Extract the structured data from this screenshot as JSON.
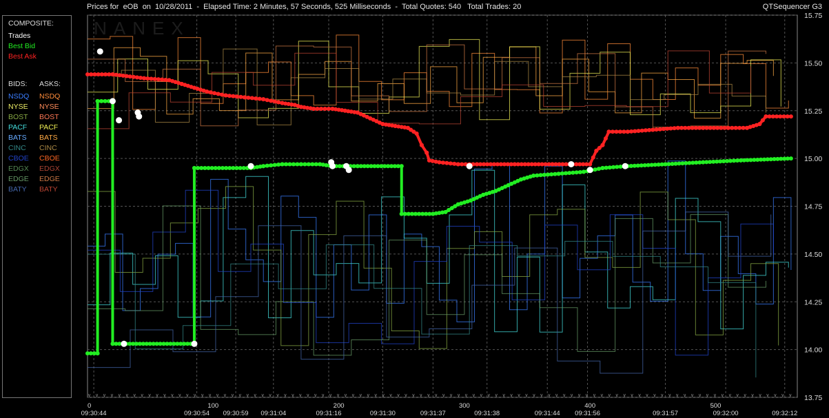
{
  "header": {
    "title": "Prices for  eOB  on  10/28/2011  -  Elapsed Time: 2 Minutes, 57 Seconds, 525 Milliseconds  -  Total Quotes: 540   Total Trades: 20",
    "app_name": "QTSequencer G3",
    "watermark": "NANEX"
  },
  "legend": {
    "composite_label": "COMPOSITE:",
    "composite": [
      {
        "label": "Trades",
        "color": "#ffffff"
      },
      {
        "label": "Best Bid",
        "color": "#22ee22"
      },
      {
        "label": "Best Ask",
        "color": "#ff2222"
      }
    ],
    "bids_label": "BIDS:",
    "asks_label": "ASKS:",
    "exchanges": [
      {
        "bid": "NSDQ",
        "ask": "NSDQ",
        "bid_color": "#3a7dff",
        "ask_color": "#ff8c3a"
      },
      {
        "bid": "NYSE",
        "ask": "NYSE",
        "bid_color": "#eeee66",
        "ask_color": "#ff8c5a"
      },
      {
        "bid": "BOST",
        "ask": "BOST",
        "bid_color": "#88aa44",
        "ask_color": "#ff7755"
      },
      {
        "bid": "PACF",
        "ask": "PACF",
        "bid_color": "#44dddd",
        "ask_color": "#eeee55"
      },
      {
        "bid": "BATS",
        "ask": "BATS",
        "bid_color": "#66aaff",
        "ask_color": "#ffaa44"
      },
      {
        "bid": "CINC",
        "ask": "CINC",
        "bid_color": "#338888",
        "ask_color": "#aa8844"
      },
      {
        "bid": "CBOE",
        "ask": "CBOE",
        "bid_color": "#2244cc",
        "ask_color": "#ff6622"
      },
      {
        "bid": "EDGX",
        "ask": "EDGX",
        "bid_color": "#558855",
        "ask_color": "#aa4433"
      },
      {
        "bid": "EDGE",
        "ask": "EDGE",
        "bid_color": "#669966",
        "ask_color": "#cc7744"
      },
      {
        "bid": "BATY",
        "ask": "BATY",
        "bid_color": "#4466aa",
        "ask_color": "#bb4433"
      }
    ]
  },
  "chart_data": {
    "type": "line",
    "title": "Prices for eOB on 10/28/2011",
    "ylim": [
      13.75,
      15.75
    ],
    "y_ticks": [
      "15.75",
      "15.50",
      "15.25",
      "15.00",
      "14.75",
      "14.50",
      "14.25",
      "14.00",
      "13.75"
    ],
    "x_ticks": [
      {
        "seq": 0,
        "label": "0"
      },
      {
        "seq": 100,
        "label": "100"
      },
      {
        "seq": 200,
        "label": "200"
      },
      {
        "seq": 300,
        "label": "300"
      },
      {
        "seq": 400,
        "label": "400"
      },
      {
        "seq": 500,
        "label": "500"
      }
    ],
    "x_range": [
      0,
      565
    ],
    "time_labels": [
      {
        "seq": 5,
        "label": "09:30:44"
      },
      {
        "seq": 87,
        "label": "09:30:54"
      },
      {
        "seq": 118,
        "label": "09:30:59"
      },
      {
        "seq": 148,
        "label": "09:31:04"
      },
      {
        "seq": 192,
        "label": "09:31:16"
      },
      {
        "seq": 235,
        "label": "09:31:30"
      },
      {
        "seq": 275,
        "label": "09:31:37"
      },
      {
        "seq": 318,
        "label": "09:31:38"
      },
      {
        "seq": 366,
        "label": "09:31:44"
      },
      {
        "seq": 398,
        "label": "09:31:56"
      },
      {
        "seq": 460,
        "label": "09:31:57"
      },
      {
        "seq": 508,
        "label": "09:32:00"
      },
      {
        "seq": 555,
        "label": "09:32:12"
      }
    ],
    "series": [
      {
        "name": "Best Ask",
        "color": "#ff2222",
        "points": [
          [
            0,
            15.44
          ],
          [
            20,
            15.44
          ],
          [
            45,
            15.42
          ],
          [
            65,
            15.41
          ],
          [
            75,
            15.39
          ],
          [
            85,
            15.37
          ],
          [
            95,
            15.35
          ],
          [
            110,
            15.33
          ],
          [
            125,
            15.32
          ],
          [
            140,
            15.31
          ],
          [
            155,
            15.29
          ],
          [
            165,
            15.28
          ],
          [
            170,
            15.27
          ],
          [
            180,
            15.26
          ],
          [
            195,
            15.26
          ],
          [
            205,
            15.25
          ],
          [
            215,
            15.24
          ],
          [
            225,
            15.21
          ],
          [
            235,
            15.18
          ],
          [
            245,
            15.17
          ],
          [
            255,
            15.16
          ],
          [
            262,
            15.13
          ],
          [
            266,
            15.07
          ],
          [
            270,
            15.03
          ],
          [
            272,
            14.99
          ],
          [
            280,
            14.98
          ],
          [
            295,
            14.97
          ],
          [
            310,
            14.97
          ],
          [
            340,
            14.97
          ],
          [
            370,
            14.97
          ],
          [
            400,
            14.97
          ],
          [
            405,
            15.04
          ],
          [
            410,
            15.07
          ],
          [
            415,
            15.14
          ],
          [
            430,
            15.14
          ],
          [
            450,
            15.15
          ],
          [
            470,
            15.16
          ],
          [
            490,
            15.16
          ],
          [
            510,
            15.16
          ],
          [
            525,
            15.16
          ],
          [
            535,
            15.18
          ],
          [
            540,
            15.22
          ],
          [
            560,
            15.22
          ]
        ]
      },
      {
        "name": "Best Bid",
        "color": "#22ee22",
        "points": [
          [
            0,
            13.98
          ],
          [
            8,
            13.98
          ],
          [
            8,
            15.3
          ],
          [
            20,
            15.3
          ],
          [
            20,
            14.03
          ],
          [
            85,
            14.03
          ],
          [
            85,
            14.95
          ],
          [
            130,
            14.95
          ],
          [
            140,
            14.96
          ],
          [
            155,
            14.97
          ],
          [
            170,
            14.97
          ],
          [
            185,
            14.97
          ],
          [
            195,
            14.96
          ],
          [
            215,
            14.96
          ],
          [
            250,
            14.96
          ],
          [
            250,
            14.71
          ],
          [
            275,
            14.71
          ],
          [
            285,
            14.72
          ],
          [
            295,
            14.76
          ],
          [
            305,
            14.78
          ],
          [
            315,
            14.81
          ],
          [
            325,
            14.83
          ],
          [
            335,
            14.86
          ],
          [
            345,
            14.89
          ],
          [
            355,
            14.91
          ],
          [
            375,
            14.92
          ],
          [
            395,
            14.93
          ],
          [
            410,
            14.95
          ],
          [
            430,
            14.96
          ],
          [
            460,
            14.97
          ],
          [
            490,
            14.98
          ],
          [
            520,
            14.99
          ],
          [
            560,
            15.0
          ]
        ]
      },
      {
        "name": "Trades",
        "color": "#ffffff",
        "points": [
          [
            10,
            15.56
          ],
          [
            20,
            15.3
          ],
          [
            25,
            15.2
          ],
          [
            29,
            14.03
          ],
          [
            40,
            15.24
          ],
          [
            41,
            15.22
          ],
          [
            85,
            14.03
          ],
          [
            130,
            14.96
          ],
          [
            194,
            14.98
          ],
          [
            195,
            14.96
          ],
          [
            206,
            14.96
          ],
          [
            208,
            14.94
          ],
          [
            304,
            14.96
          ],
          [
            385,
            14.97
          ],
          [
            400,
            14.94
          ],
          [
            428,
            14.96
          ]
        ]
      }
    ]
  }
}
